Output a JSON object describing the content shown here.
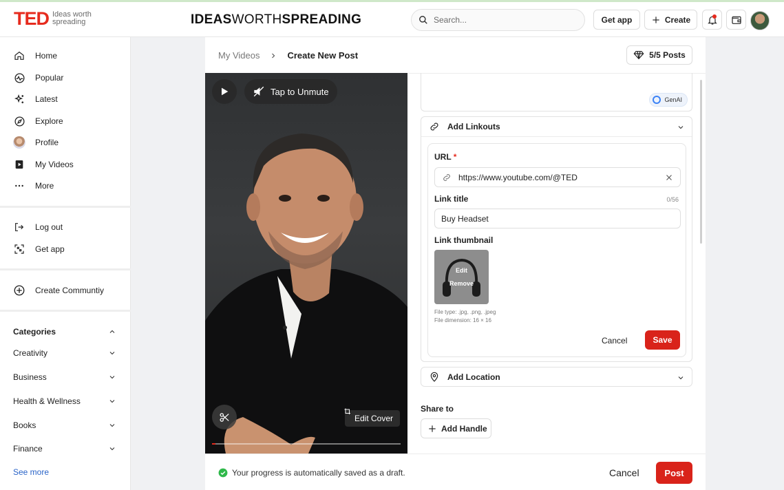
{
  "header": {
    "logo_text": "TED",
    "logo_tagline": "Ideas worth spreading",
    "slogan_part1": "IDEAS",
    "slogan_part2": "WORTH",
    "slogan_part3": "SPREADING",
    "search_placeholder": "Search...",
    "get_app_label": "Get app",
    "create_label": "Create"
  },
  "sidebar": {
    "nav": [
      {
        "label": "Home",
        "icon": "home-icon"
      },
      {
        "label": "Popular",
        "icon": "popular-icon"
      },
      {
        "label": "Latest",
        "icon": "sparkle-icon"
      },
      {
        "label": "Explore",
        "icon": "compass-icon"
      },
      {
        "label": "Profile",
        "icon": "profile-avatar-icon"
      },
      {
        "label": "My Videos",
        "icon": "video-icon"
      },
      {
        "label": "More",
        "icon": "more-icon"
      }
    ],
    "logout_label": "Log out",
    "get_app_label": "Get app",
    "create_community_label": "Create Communtiy",
    "categories_title": "Categories",
    "categories": [
      "Creativity",
      "Business",
      "Health & Wellness",
      "Books",
      "Finance"
    ],
    "see_more_label": "See more"
  },
  "main": {
    "breadcrumb_parent": "My Videos",
    "breadcrumb_current": "Create New Post",
    "posts_quota": "5/5 Posts",
    "video": {
      "unmute_label": "Tap to Unmute",
      "edit_cover_label": "Edit Cover",
      "progress": 0.02
    },
    "genai_label": "GenAI",
    "linkouts": {
      "section_label": "Add Linkouts",
      "url_label": "URL",
      "url_required_mark": "*",
      "url_value": "https://www.youtube.com/@TED",
      "link_title_label": "Link title",
      "link_title_counter": "0/56",
      "link_title_value": "Buy Headset",
      "thumbnail_label": "Link thumbnail",
      "thumb_edit_label": "Edit",
      "thumb_remove_label": "Remove",
      "file_type_text": "File type: .jpg, .png, .jpeg",
      "file_dimension_text": "File dimension: 16 × 16",
      "cancel_label": "Cancel",
      "save_label": "Save"
    },
    "location_label": "Add Location",
    "share_to_label": "Share to",
    "add_handle_label": "Add Handle",
    "footer": {
      "draft_status": "Your progress is automatically saved as a draft.",
      "cancel_label": "Cancel",
      "post_label": "Post"
    }
  },
  "colors": {
    "brand_red": "#e62b1e",
    "button_red": "#d9231a",
    "link_blue": "#2a64c8",
    "success_green": "#2fb84a"
  }
}
